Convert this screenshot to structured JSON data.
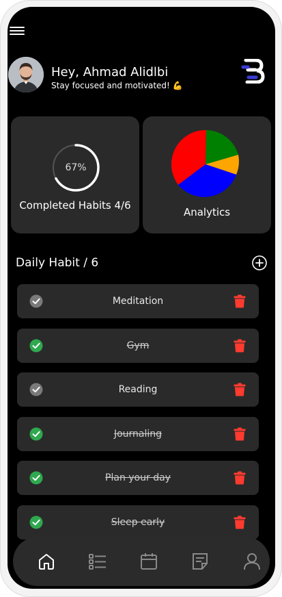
{
  "header": {
    "greeting": "Hey, Ahmad Alidlbi",
    "tagline": "Stay focused and motivated! 💪",
    "logo_letter": "B"
  },
  "stats": {
    "progress_percent_label": "67%",
    "progress_fraction": 0.67,
    "completed_label": "Completed Habits 4/6",
    "analytics_label": "Analytics",
    "pie_colors": [
      "#ff0000",
      "#008000",
      "#ffa500",
      "#0000ff"
    ]
  },
  "habits": {
    "title": "Daily Habit / 6",
    "items": [
      {
        "name": "Meditation",
        "done": false
      },
      {
        "name": "Gym",
        "done": true
      },
      {
        "name": "Reading",
        "done": false
      },
      {
        "name": "Journaling",
        "done": true
      },
      {
        "name": "Plan your day",
        "done": true
      },
      {
        "name": "Sleep early",
        "done": true
      }
    ]
  },
  "colors": {
    "check_done": "#2fa84f",
    "check_pending": "#7a7a7a",
    "delete": "#ff3b30"
  },
  "nav": {
    "items": [
      "home-icon",
      "list-icon",
      "calendar-icon",
      "notes-icon",
      "profile-icon"
    ]
  }
}
